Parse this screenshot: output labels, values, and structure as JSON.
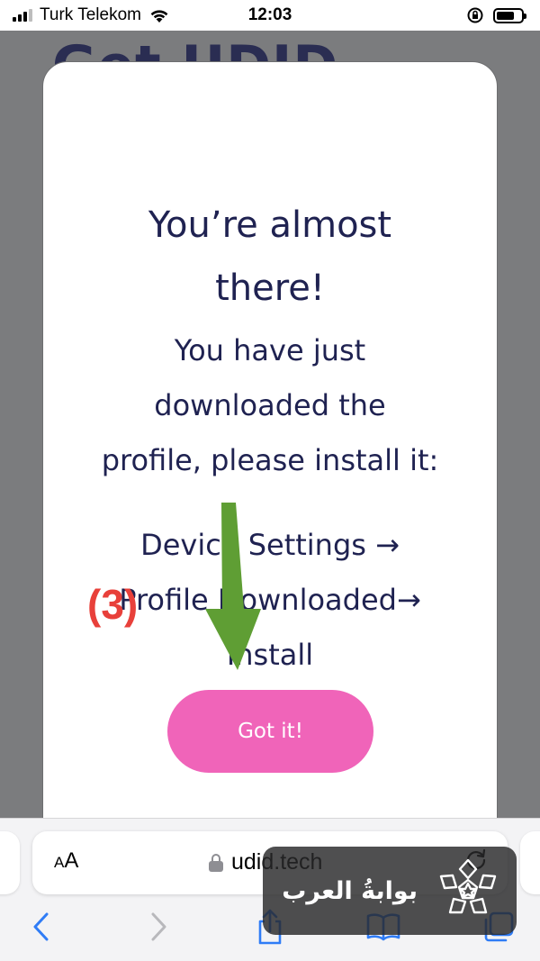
{
  "status_bar": {
    "carrier": "Turk Telekom",
    "time": "12:03"
  },
  "background": {
    "page_title": "Get UDID"
  },
  "modal": {
    "title_line1": "You’re almost",
    "title_line2": "there!",
    "body_line1": "You have just",
    "body_line2": "downloaded the",
    "body_line3": "profile, please install it:",
    "step_line1": "Device Settings →",
    "step_line2": "Profile Downloaded→",
    "step_line3": "Install",
    "button_label": "Got it!"
  },
  "annotation": {
    "step_label": "(3)",
    "label_color": "#e8403a",
    "arrow_color": "#5f9e34"
  },
  "safari": {
    "aa_label_small": "A",
    "aa_label_large": "A",
    "url": "udid.tech"
  },
  "watermark": {
    "text": "بوابةُ العرب"
  },
  "colors": {
    "button": "#f064b9",
    "heading_text": "#1f2251",
    "overlay": "#7b7c7e",
    "safari_blue": "#2f7cf6"
  }
}
